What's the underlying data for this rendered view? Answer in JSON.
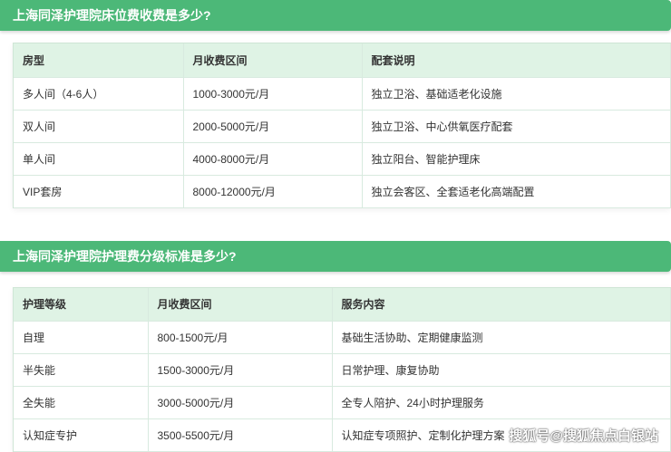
{
  "bed_section": {
    "title": "上海同泽护理院床位费收费是多少?",
    "headers": [
      "房型",
      "月收费区间",
      "配套说明"
    ],
    "rows": [
      [
        "多人间（4-6人）",
        "1000-3000元/月",
        "独立卫浴、基础适老化设施"
      ],
      [
        "双人间",
        "2000-5000元/月",
        "独立卫浴、中心供氧医疗配套"
      ],
      [
        "单人间",
        "4000-8000元/月",
        "独立阳台、智能护理床"
      ],
      [
        "VIP套房",
        "8000-12000元/月",
        "独立会客区、全套适老化高端配置"
      ]
    ]
  },
  "care_section": {
    "title": "上海同泽护理院护理费分级标准是多少?",
    "headers": [
      "护理等级",
      "月收费区间",
      "服务内容"
    ],
    "rows": [
      [
        "自理",
        "800-1500元/月",
        "基础生活协助、定期健康监测"
      ],
      [
        "半失能",
        "1500-3000元/月",
        "日常护理、康复协助"
      ],
      [
        "全失能",
        "3000-5000元/月",
        "全专人陪护、24小时护理服务"
      ],
      [
        "认知症专护",
        "3500-5500元/月",
        "认知症专项照护、定制化护理方案"
      ]
    ]
  },
  "watermark": "搜狐号@搜狐焦点白银站"
}
